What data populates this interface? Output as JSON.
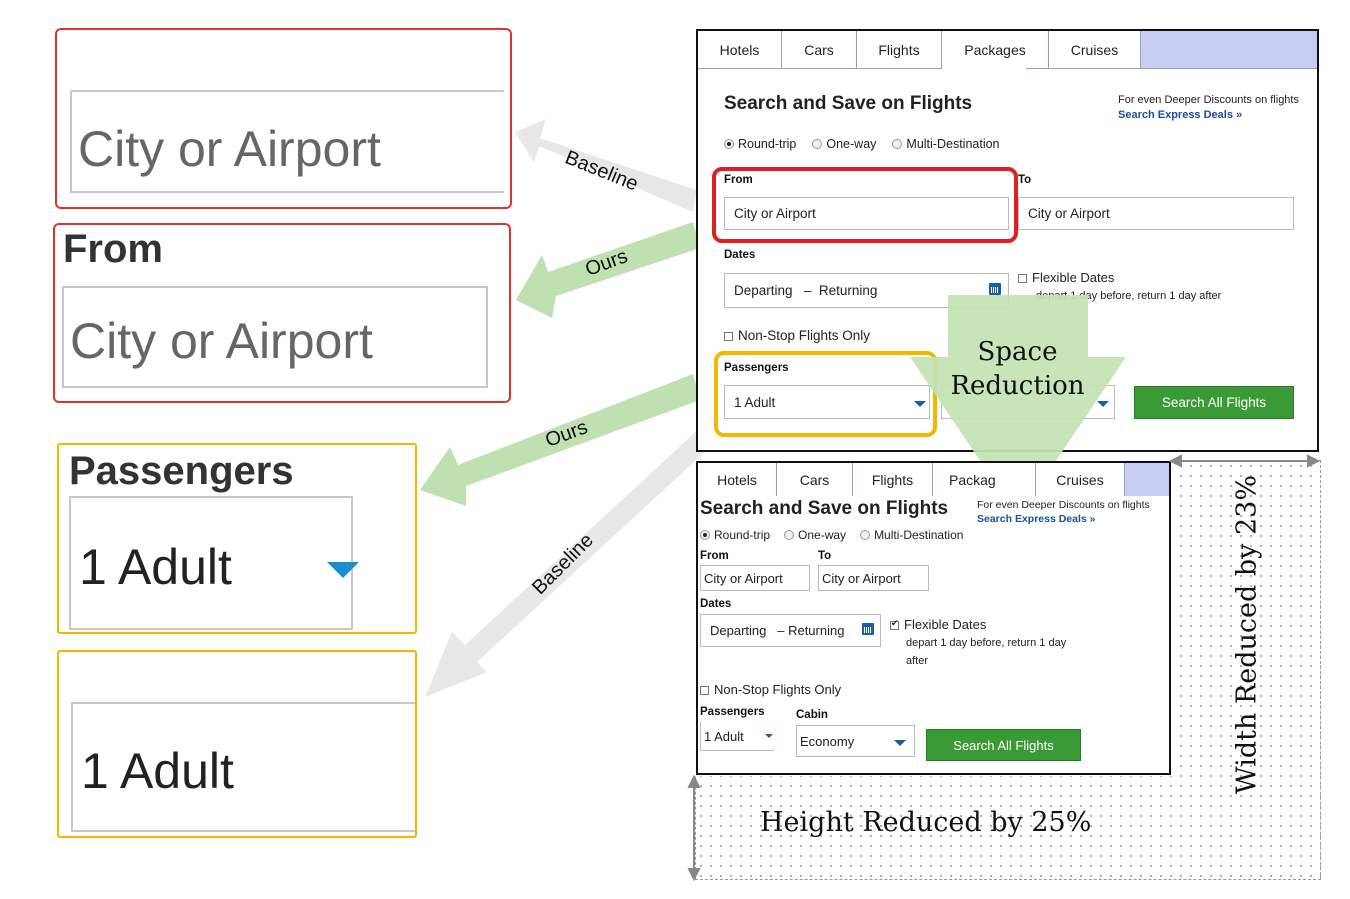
{
  "crops": {
    "baseline_from_text": "City or Airport",
    "ours_from_label": "From",
    "ours_from_text": "City or Airport",
    "ours_passengers_label": "Passengers",
    "ours_passengers_value": "1 Adult",
    "baseline_passengers_value": "1 Adult"
  },
  "arrows": {
    "baseline_top": "Baseline",
    "ours_top": "Ours",
    "ours_bottom": "Ours",
    "baseline_bottom": "Baseline"
  },
  "reduction": {
    "big_arrow_label_line1": "Space",
    "big_arrow_label_line2": "Reduction",
    "width_label": "Width Reduced by 23%",
    "height_label": "Height Reduced by 25%"
  },
  "form_original": {
    "tabs": [
      "Hotels",
      "Cars",
      "Flights",
      "Packages",
      "Cruises"
    ],
    "active_tab": "Flights",
    "title": "Search and Save on Flights",
    "promo_line1": "For even Deeper Discounts on flights",
    "promo_link": "Search Express Deals »",
    "trip_types": [
      "Round-trip",
      "One-way",
      "Multi-Destination"
    ],
    "from_label": "From",
    "from_placeholder": "City or Airport",
    "to_label": "To",
    "to_placeholder": "City or Airport",
    "dates_label": "Dates",
    "departing": "Departing",
    "dash": "–",
    "returning": "Returning",
    "flexible_label": "Flexible Dates",
    "flexible_note": "depart 1 day before, return 1 day after",
    "nonstop_label": "Non-Stop Flights Only",
    "passengers_label": "Passengers",
    "passengers_value": "1 Adult",
    "search_button": "Search All Flights"
  },
  "form_reduced": {
    "tabs": [
      "Hotels",
      "Cars",
      "Flights",
      "Packag",
      "Cruises"
    ],
    "title": "Search and Save on Flights",
    "promo_line1": "For even Deeper Discounts on flights",
    "promo_link": "Search Express Deals »",
    "trip_types": [
      "Round-trip",
      "One-way",
      "Multi-Destination"
    ],
    "from_label": "From",
    "from_placeholder": "City or Airport",
    "to_label": "To",
    "to_placeholder": "City or Airport",
    "dates_label": "Dates",
    "departing": "Departing",
    "dash": "–",
    "returning": "Returning",
    "flexible_label": "Flexible Dates",
    "flexible_note_line1": "depart 1 day before, return 1 day",
    "flexible_note_line2": "after",
    "nonstop_label": "Non-Stop Flights Only",
    "passengers_label": "Passengers",
    "passengers_value": "1 Adult",
    "cabin_label": "Cabin",
    "cabin_value": "Economy",
    "search_button": "Search All Flights"
  },
  "colors": {
    "red_highlight": "#e02020",
    "yellow_highlight": "#f2b800",
    "ours_arrow": "#bfe0b0",
    "baseline_arrow": "#e8e8e8",
    "tab_bar": "#c7cdf0",
    "search_button": "#3a9b36"
  }
}
